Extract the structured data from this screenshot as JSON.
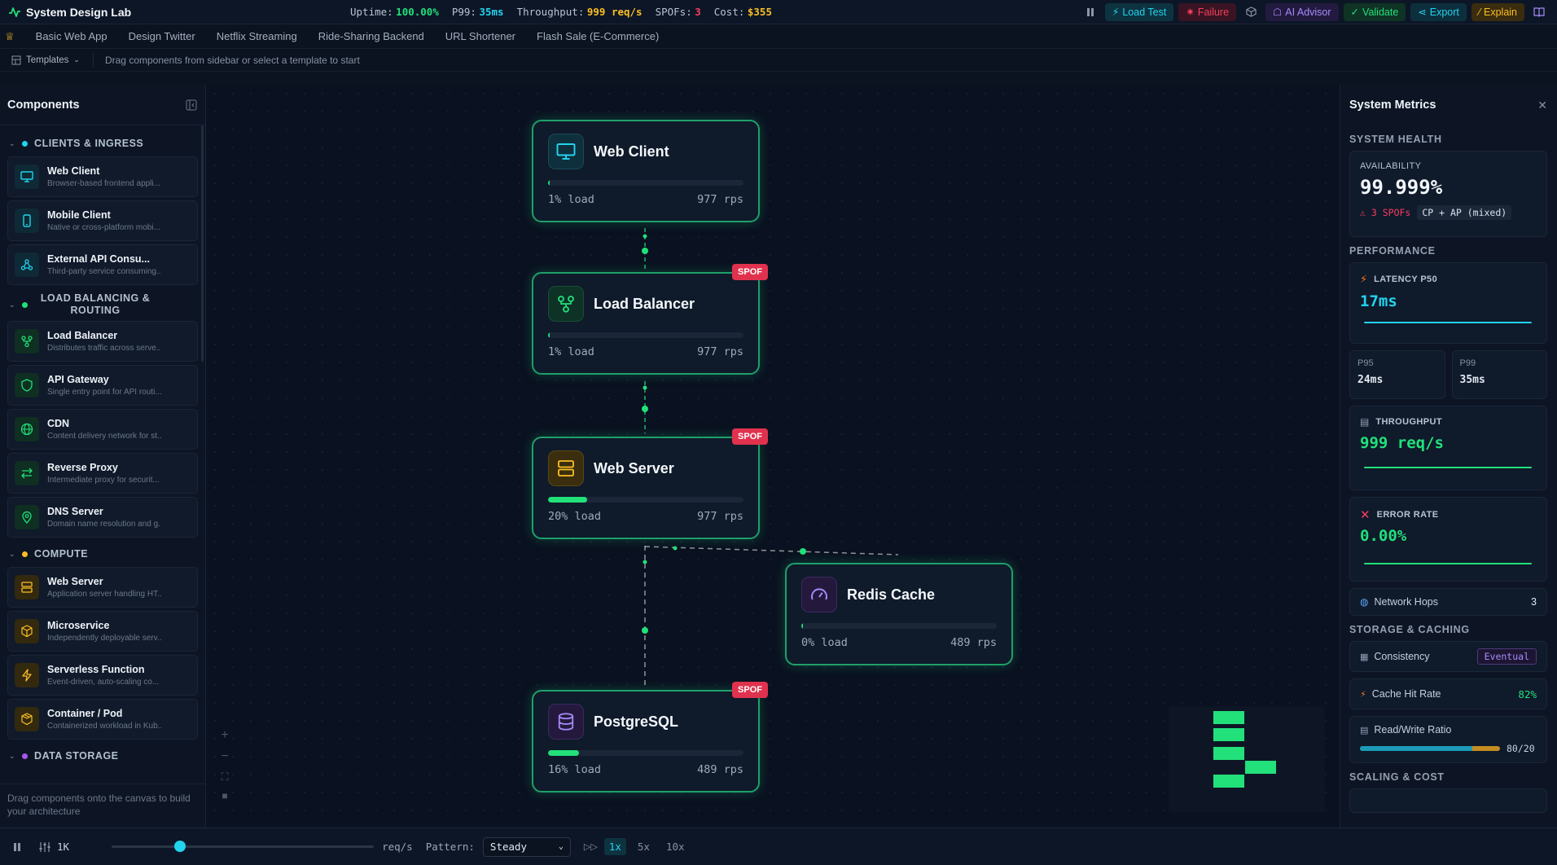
{
  "topbar": {
    "brand": "System Design Lab",
    "stats": [
      {
        "label": "Uptime:",
        "value": "100.00%",
        "color": "#22e07a"
      },
      {
        "label": "P99:",
        "value": "35ms",
        "color": "#22d3ee"
      },
      {
        "label": "Throughput:",
        "value": "999 req/s",
        "color": "#fbbf24"
      },
      {
        "label": "SPOFs:",
        "value": "3",
        "color": "#f43f5e"
      },
      {
        "label": "Cost:",
        "value": "$355",
        "color": "#fbbf24"
      }
    ],
    "buttons": {
      "load_test": "Load Test",
      "failure": "Failure",
      "ai_advisor": "AI Advisor",
      "validate": "Validate",
      "export": "Export",
      "explain": "Explain"
    }
  },
  "tabs": [
    "Basic Web App",
    "Design Twitter",
    "Netflix Streaming",
    "Ride-Sharing Backend",
    "URL Shortener",
    "Flash Sale (E-Commerce)"
  ],
  "hintrow": {
    "templates_label": "Templates",
    "hint": "Drag components from sidebar or select a template to start"
  },
  "sidebar": {
    "title": "Components",
    "categories": [
      {
        "name": "CLIENTS & INGRESS",
        "color": "#22d3ee"
      },
      {
        "name": "LOAD BALANCING & ROUTING",
        "color": "#22e07a"
      },
      {
        "name": "COMPUTE",
        "color": "#fbbf24"
      },
      {
        "name": "DATA STORAGE",
        "color": "#a855f7"
      }
    ],
    "items": {
      "web_client": {
        "name": "Web Client",
        "desc": "Browser-based frontend appli..."
      },
      "mobile_client": {
        "name": "Mobile Client",
        "desc": "Native or cross-platform mobi..."
      },
      "external_api": {
        "name": "External API Consu...",
        "desc": "Third-party service consuming..."
      },
      "load_balancer": {
        "name": "Load Balancer",
        "desc": "Distributes traffic across serve..."
      },
      "api_gateway": {
        "name": "API Gateway",
        "desc": "Single entry point for API routi..."
      },
      "cdn": {
        "name": "CDN",
        "desc": "Content delivery network for st..."
      },
      "reverse_proxy": {
        "name": "Reverse Proxy",
        "desc": "Intermediate proxy for securit..."
      },
      "dns_server": {
        "name": "DNS Server",
        "desc": "Domain name resolution and g..."
      },
      "web_server": {
        "name": "Web Server",
        "desc": "Application server handling HT..."
      },
      "microservice": {
        "name": "Microservice",
        "desc": "Independently deployable serv..."
      },
      "serverless": {
        "name": "Serverless Function",
        "desc": "Event-driven, auto-scaling co..."
      },
      "container": {
        "name": "Container / Pod",
        "desc": "Containerized workload in Kub..."
      }
    },
    "footer": "Drag components onto the canvas to build your architecture"
  },
  "canvas": {
    "spof_label": "SPOF",
    "nodes": {
      "web_client": {
        "title": "Web Client",
        "load_text": "1% load",
        "load_pct": 1,
        "rps": "977 rps"
      },
      "load_balancer": {
        "title": "Load Balancer",
        "load_text": "1% load",
        "load_pct": 1,
        "rps": "977 rps"
      },
      "web_server": {
        "title": "Web Server",
        "load_text": "20% load",
        "load_pct": 20,
        "rps": "977 rps"
      },
      "redis": {
        "title": "Redis Cache",
        "load_text": "0% load",
        "load_pct": 0,
        "rps": "489 rps"
      },
      "postgres": {
        "title": "PostgreSQL",
        "load_text": "16% load",
        "load_pct": 16,
        "rps": "489 rps"
      }
    }
  },
  "metrics": {
    "title": "System Metrics",
    "system_health": "SYSTEM HEALTH",
    "availability_label": "AVAILABILITY",
    "availability_value": "99.999%",
    "spofs_text": "3 SPOFs",
    "cap_text": "CP + AP (mixed)",
    "performance": "PERFORMANCE",
    "latency_label": "LATENCY P50",
    "latency_value": "17ms",
    "p95_label": "P95",
    "p95_value": "24ms",
    "p99_label": "P99",
    "p99_value": "35ms",
    "throughput_label": "THROUGHPUT",
    "throughput_value": "999 req/s",
    "error_label": "ERROR RATE",
    "error_value": "0.00%",
    "network_hops_label": "Network Hops",
    "network_hops_value": "3",
    "storage": "STORAGE & CACHING",
    "consistency_label": "Consistency",
    "consistency_value": "Eventual",
    "cache_hit_label": "Cache Hit Rate",
    "cache_hit_value": "82%",
    "rw_label": "Read/Write Ratio",
    "rw_value": "80/20",
    "rw_read_pct": 80,
    "scaling": "SCALING & COST"
  },
  "bottombar": {
    "rate_value": "1K",
    "rate_unit": "req/s",
    "rate_slider_pct": 26,
    "pattern_label": "Pattern:",
    "pattern_value": "Steady",
    "speeds": [
      "1x",
      "5x",
      "10x"
    ],
    "active_speed": "1x"
  }
}
